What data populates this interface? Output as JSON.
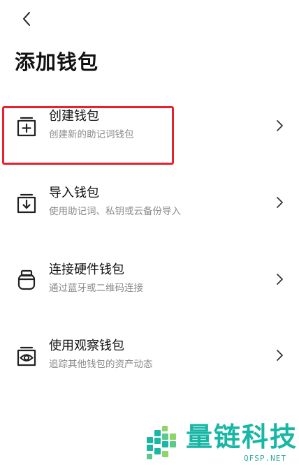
{
  "header": {
    "back_icon": "chevron-left-icon",
    "title": "添加钱包"
  },
  "options": [
    {
      "title": "创建钱包",
      "subtitle": "创建新的助记词钱包",
      "icon": "plus-box-icon"
    },
    {
      "title": "导入钱包",
      "subtitle": "使用助记词、私钥或云备份导入",
      "icon": "import-box-icon"
    },
    {
      "title": "连接硬件钱包",
      "subtitle": "通过蓝牙或二维码连接",
      "icon": "hardware-wallet-icon"
    },
    {
      "title": "使用观察钱包",
      "subtitle": "追踪其他钱包的资产动态",
      "icon": "eye-box-icon"
    }
  ],
  "annotation": {
    "highlight_color": "#e5222d"
  },
  "watermark": {
    "name": "量链科技",
    "domain": "QFSP.NET",
    "color": "#17b6a5"
  }
}
